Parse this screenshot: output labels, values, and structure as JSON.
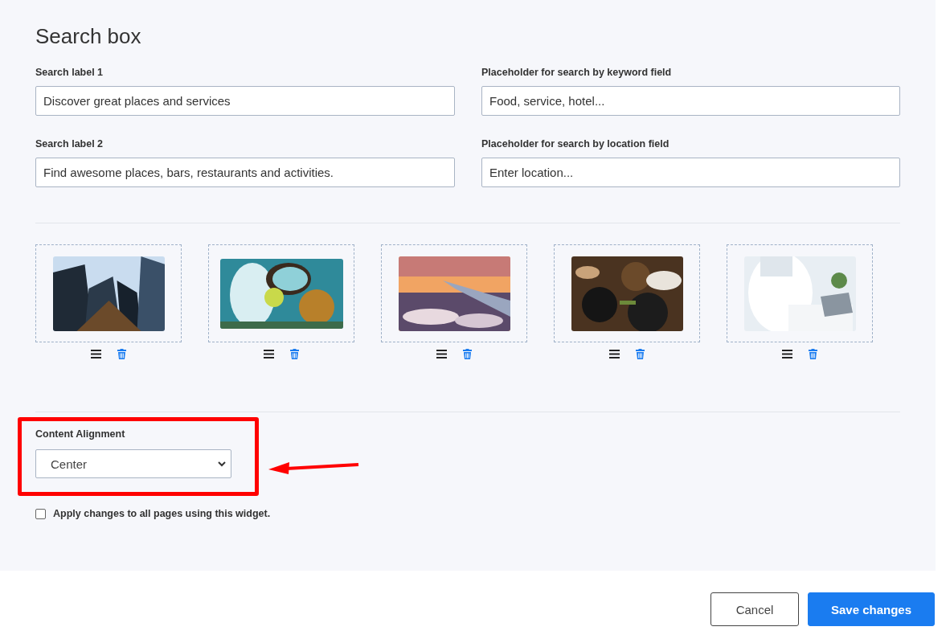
{
  "title": "Search box",
  "fields": [
    {
      "label": "Search label 1",
      "value": "Discover great places and services"
    },
    {
      "label": "Placeholder for search by keyword field",
      "value": "Food, service, hotel..."
    },
    {
      "label": "Search label 2",
      "value": "Find awesome places, bars, restaurants and activities."
    },
    {
      "label": "Placeholder for search by location field",
      "value": "Enter location..."
    }
  ],
  "alignment": {
    "label": "Content Alignment",
    "value": "Center"
  },
  "apply_all": {
    "label": "Apply changes to all pages using this widget.",
    "checked": false
  },
  "buttons": [
    {
      "label": "Cancel",
      "kind": "secondary"
    },
    {
      "label": "Save changes",
      "kind": "primary"
    }
  ]
}
